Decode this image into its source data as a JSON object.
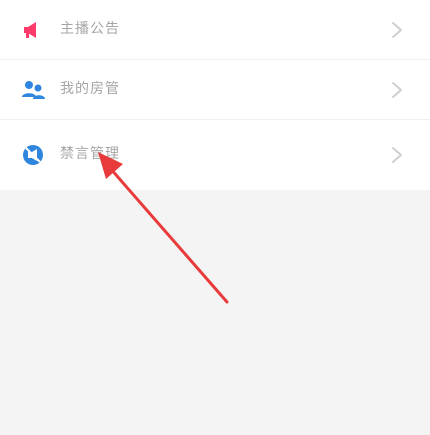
{
  "menu": {
    "items": [
      {
        "label": "主播公告",
        "icon": "megaphone-icon",
        "icon_color": "#ff3b6b"
      },
      {
        "label": "我的房管",
        "icon": "users-icon",
        "icon_color": "#2e86de"
      },
      {
        "label": "禁言管理",
        "icon": "mute-icon",
        "icon_color": "#2e86de"
      }
    ]
  },
  "annotation": {
    "arrow_color": "#e83a3a"
  }
}
